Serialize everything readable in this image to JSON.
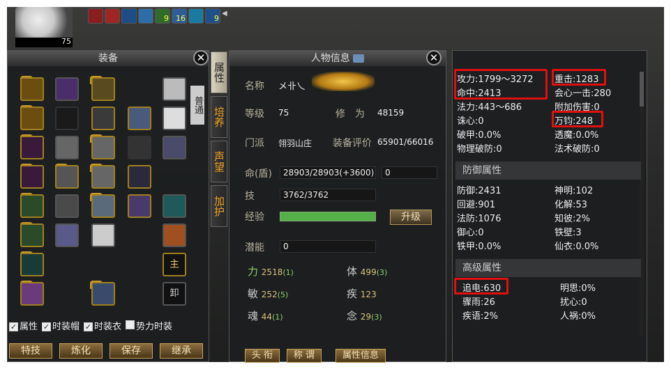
{
  "player": {
    "level": "75"
  },
  "buff_bar": {
    "stacks": [
      "9",
      "16",
      "9"
    ]
  },
  "equipment": {
    "title": "装备",
    "side_tab": "普通",
    "slot_main": "主",
    "slot_off": "卸",
    "checkboxes": [
      {
        "label": "属性",
        "checked": true
      },
      {
        "label": "时装帽",
        "checked": true
      },
      {
        "label": "时装衣",
        "checked": true
      },
      {
        "label": "势力时装",
        "checked": false
      }
    ],
    "buttons": [
      "特技",
      "炼化",
      "保存",
      "继承"
    ]
  },
  "side_tabs": [
    "属性",
    "培养",
    "声望",
    "加护"
  ],
  "char_info": {
    "title": "人物信息",
    "name_label": "名称",
    "name_value": "メ卝乀",
    "level_label": "等级",
    "level_value": "75",
    "cultivation_label": "修　为",
    "cultivation_value": "48159",
    "sect_label": "门派",
    "sect_value": "翎羽山庄",
    "gear_score_label": "装备评价",
    "gear_score_value": "65901/66016",
    "hp_label": "命(盾)",
    "hp_value": "28903/28903(+3600)",
    "shield_value": "0",
    "skill_label": "技",
    "skill_value": "3762/3762",
    "exp_label": "经验",
    "exp_fill": 1.0,
    "upgrade_button": "升级",
    "potential_label": "潜能",
    "potential_value": "0",
    "attributes": [
      {
        "label": "力",
        "value": "2518",
        "bonus": "(1)"
      },
      {
        "label": "体",
        "value": "499",
        "bonus": "(3)"
      },
      {
        "label": "敏",
        "value": "252",
        "bonus": "(5)"
      },
      {
        "label": "疾",
        "value": "123",
        "bonus": ""
      },
      {
        "label": "魂",
        "value": "44",
        "bonus": "(1)"
      },
      {
        "label": "念",
        "value": "29",
        "bonus": "(3)"
      }
    ],
    "bottom_buttons": [
      "头 衔",
      "称 谓",
      "属性信息"
    ]
  },
  "stats": {
    "attack": [
      "攻力:1799～3272",
      "命中:2413",
      "法力:443～686",
      "诛心:0",
      "破甲:0.0%",
      "物理破防:0"
    ],
    "attack_right": [
      "重击:1283",
      "会心一击:280",
      "附加伤害:0",
      "万钧:248",
      "透魔:0.0%",
      "法术破防:0"
    ],
    "defense_title": "防御属性",
    "defense": [
      "防御:2431",
      "回避:901",
      "法防:1076",
      "御心:0",
      "铁甲:0.0%"
    ],
    "defense_right": [
      "神明:102",
      "化解:53",
      "知彼:2%",
      "铁壁:3",
      "仙衣:0.0%"
    ],
    "advanced_title": "高级属性",
    "advanced": [
      "追电:630",
      "骤雨:26",
      "疾语:2%"
    ],
    "advanced_right": [
      "明思:0%",
      "扰心:0",
      "人祸:0%"
    ]
  },
  "colors": {
    "highlight": "#e01010",
    "accent": "#f0a020",
    "bonus": "#8fd06a"
  }
}
